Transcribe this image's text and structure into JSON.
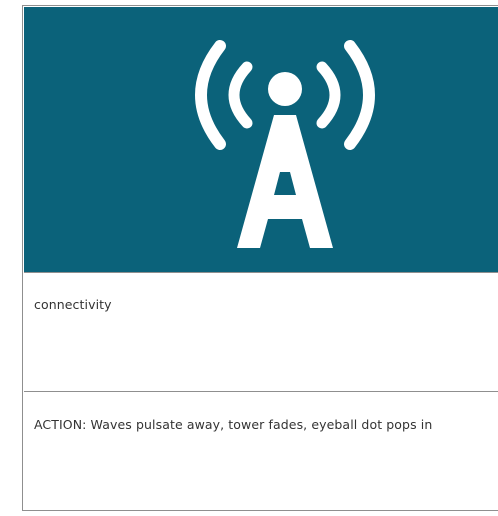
{
  "icon": {
    "name": "signal-tower-icon",
    "background_color": "#0b627a",
    "foreground_color": "#ffffff"
  },
  "label": "connectivity",
  "action": "ACTION: Waves pulsate away, tower fades, eyeball dot pops in"
}
